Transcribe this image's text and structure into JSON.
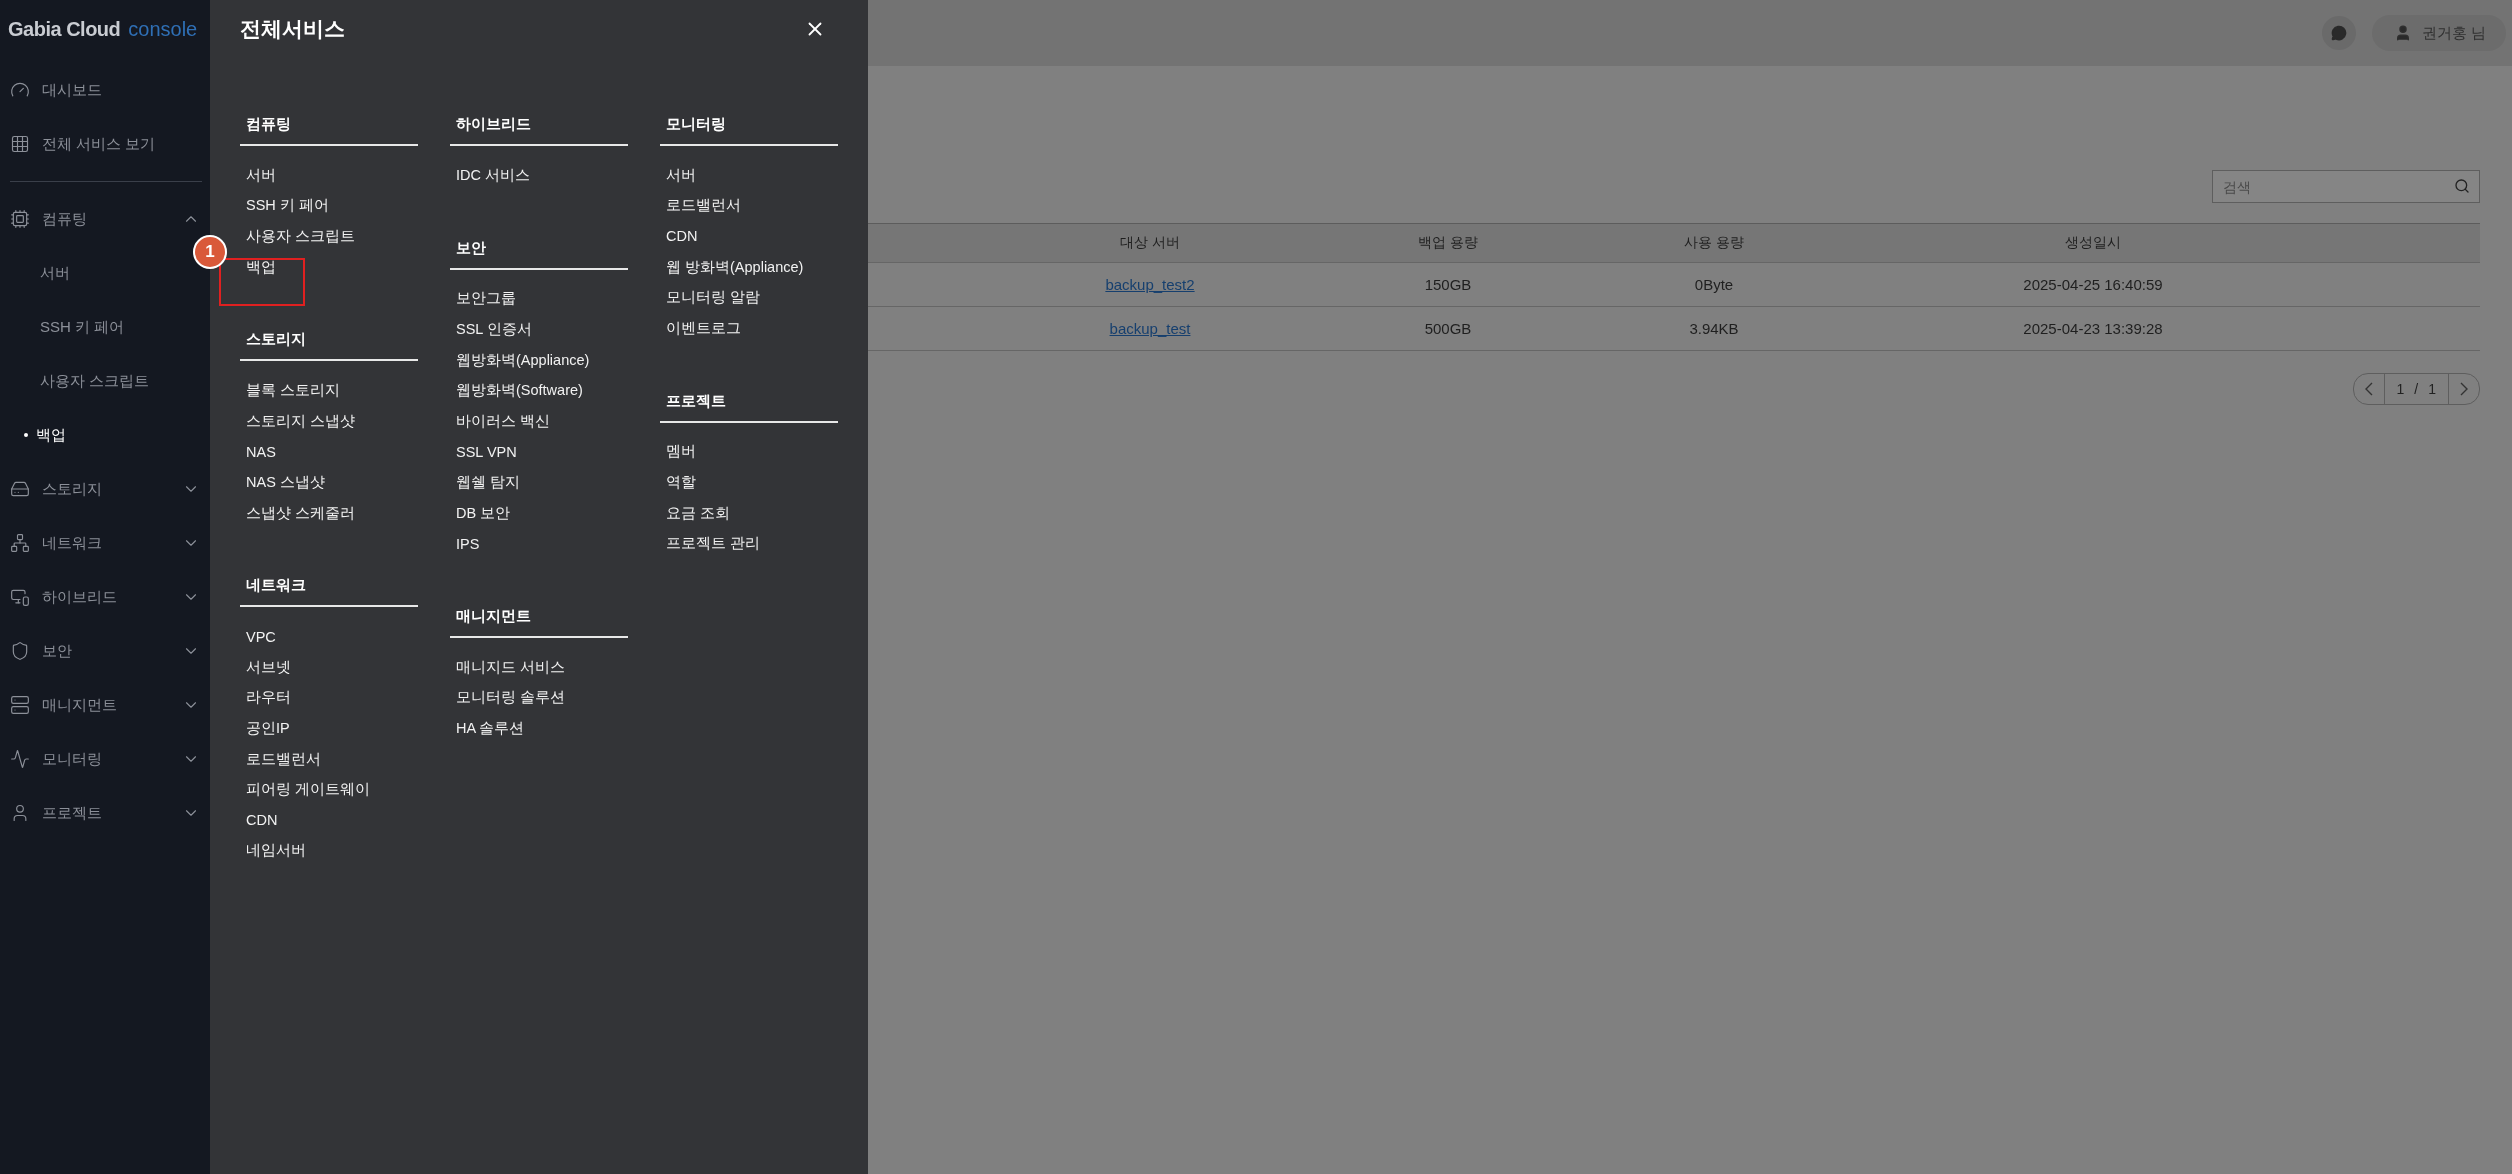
{
  "sidebar": {
    "logo": {
      "brand": "Gabia Cloud",
      "product": "console"
    },
    "links": [
      {
        "label": "대시보드"
      },
      {
        "label": "전체 서비스 보기"
      }
    ],
    "groups": [
      {
        "label": "컴퓨팅",
        "expanded": true,
        "children": [
          {
            "label": "서버",
            "selected": false
          },
          {
            "label": "SSH 키 페어",
            "selected": false
          },
          {
            "label": "사용자 스크립트",
            "selected": false
          },
          {
            "label": "백업",
            "selected": true
          }
        ]
      },
      {
        "label": "스토리지",
        "expanded": false
      },
      {
        "label": "네트워크",
        "expanded": false
      },
      {
        "label": "하이브리드",
        "expanded": false
      },
      {
        "label": "보안",
        "expanded": false
      },
      {
        "label": "매니지먼트",
        "expanded": false
      },
      {
        "label": "모니터링",
        "expanded": false
      },
      {
        "label": "프로젝트",
        "expanded": false
      }
    ]
  },
  "header": {
    "user": "권거홍 님"
  },
  "content": {
    "search": {
      "placeholder": "검색"
    },
    "table": {
      "columns": [
        "대상 서버",
        "백업 용량",
        "사용 용량",
        "생성일시"
      ],
      "rows": [
        [
          "backup_test2",
          "150GB",
          "0Byte",
          "2025-04-25 16:40:59"
        ],
        [
          "backup_test",
          "500GB",
          "3.94KB",
          "2025-04-23 13:39:28"
        ]
      ]
    },
    "pagination": {
      "current": "1",
      "separator": "/",
      "total": "1"
    }
  },
  "services_menu": {
    "title": "전체서비스",
    "columns": [
      [
        {
          "heading": "컴퓨팅",
          "items": [
            {
              "label": "서버"
            },
            {
              "label": "SSH 키 페어"
            },
            {
              "label": "사용자 스크립트"
            },
            {
              "label": "백업",
              "highlighted": true,
              "badge": "1"
            }
          ]
        },
        {
          "heading": "스토리지",
          "items": [
            {
              "label": "블록 스토리지"
            },
            {
              "label": "스토리지 스냅샷"
            },
            {
              "label": "NAS"
            },
            {
              "label": "NAS 스냅샷"
            },
            {
              "label": "스냅샷 스케줄러"
            }
          ]
        },
        {
          "heading": "네트워크",
          "items": [
            {
              "label": "VPC"
            },
            {
              "label": "서브넷"
            },
            {
              "label": "라우터"
            },
            {
              "label": "공인IP"
            },
            {
              "label": "로드밸런서"
            },
            {
              "label": "피어링 게이트웨이"
            },
            {
              "label": "CDN"
            },
            {
              "label": "네임서버"
            }
          ]
        }
      ],
      [
        {
          "heading": "하이브리드",
          "items": [
            {
              "label": "IDC 서비스"
            }
          ]
        },
        {
          "heading": "보안",
          "items": [
            {
              "label": "보안그룹"
            },
            {
              "label": "SSL 인증서"
            },
            {
              "label": "웹방화벽(Appliance)"
            },
            {
              "label": "웹방화벽(Software)"
            },
            {
              "label": "바이러스 백신"
            },
            {
              "label": "SSL VPN"
            },
            {
              "label": "웹쉘 탐지"
            },
            {
              "label": "DB 보안"
            },
            {
              "label": "IPS"
            }
          ]
        },
        {
          "heading": "매니지먼트",
          "items": [
            {
              "label": "매니지드 서비스"
            },
            {
              "label": "모니터링 솔루션"
            },
            {
              "label": "HA 솔루션"
            }
          ]
        }
      ],
      [
        {
          "heading": "모니터링",
          "items": [
            {
              "label": "서버"
            },
            {
              "label": "로드밸런서"
            },
            {
              "label": "CDN"
            },
            {
              "label": "웹 방화벽(Appliance)"
            },
            {
              "label": "모니터링 알람"
            },
            {
              "label": "이벤트로그"
            }
          ]
        },
        {
          "heading": "프로젝트",
          "items": [
            {
              "label": "멤버"
            },
            {
              "label": "역할"
            },
            {
              "label": "요금 조회"
            },
            {
              "label": "프로젝트 관리"
            }
          ]
        }
      ]
    ]
  }
}
